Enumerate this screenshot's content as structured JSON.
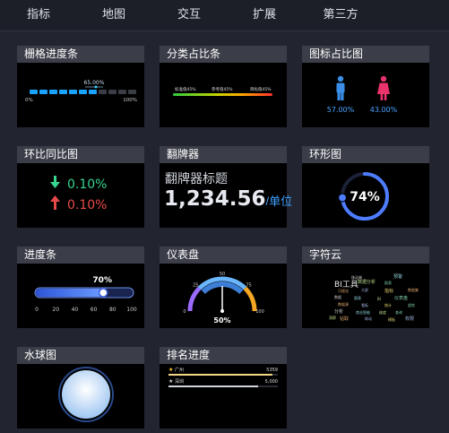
{
  "nav": {
    "tabs": [
      "指标",
      "地图",
      "交互",
      "扩展",
      "第三方"
    ]
  },
  "cards": {
    "grid_progress": {
      "title": "栅格进度条",
      "value_label": "65.00%",
      "left": "0%",
      "right": "100%",
      "filled_cells": 7,
      "total_cells": 11
    },
    "category_bar": {
      "title": "分类占比条",
      "labels": [
        "标准值45%",
        "参考值45%",
        "目标值45%"
      ]
    },
    "icon_ratio": {
      "title": "图标占比图",
      "male": "57.00%",
      "female": "43.00%"
    },
    "yoy": {
      "title": "环比同比图",
      "up": "0.10%",
      "down": "0.10%"
    },
    "flip": {
      "title": "翻牌器",
      "heading": "翻牌器标题",
      "number": "1,234.56",
      "unit": "/单位"
    },
    "ring": {
      "title": "环形图",
      "value": "74%",
      "fraction": 0.74
    },
    "progress": {
      "title": "进度条",
      "value": "70%",
      "fraction": 0.7,
      "ticks": [
        "0",
        "20",
        "40",
        "60",
        "80",
        "100"
      ]
    },
    "gauge": {
      "title": "仪表盘",
      "value": "50%",
      "fraction": 0.5,
      "ticks": [
        "0",
        "25",
        "50",
        "75",
        "100"
      ]
    },
    "wordcloud": {
      "title": "字符云",
      "headline": "BI工具",
      "words": [
        "数据分析",
        "报表",
        "可视化",
        "大屏",
        "指标",
        "数据",
        "图表",
        "BI",
        "仪表盘",
        "数据源",
        "看板",
        "统计",
        "分析",
        "商业智能",
        "维度",
        "查询",
        "钻取",
        "联动",
        "模板",
        "移动端",
        "预警",
        "洞察",
        "趋势",
        "数据集",
        "权限"
      ]
    },
    "liquid": {
      "title": "水球图"
    },
    "rank": {
      "title": "排名进度",
      "items": [
        {
          "name": "广州",
          "value": "5359",
          "fraction": 0.95
        },
        {
          "name": "深圳",
          "value": "5,000",
          "fraction": 0.82
        }
      ]
    }
  },
  "colors": {
    "accent": "#1aa3ff",
    "up": "#36d48f",
    "down": "#e84a4a",
    "ring": "#4d7cff",
    "male": "#3a8ee8",
    "female": "#e8336b",
    "gauge_blue": "#6ab7ff",
    "gauge_orange": "#f5a623",
    "gauge_purple": "#9b6bff"
  }
}
